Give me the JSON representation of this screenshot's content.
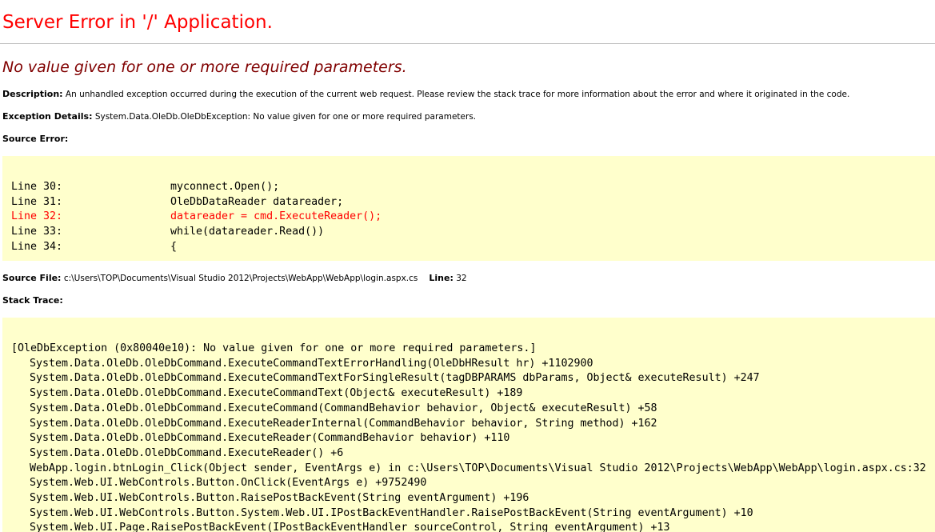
{
  "title": "Server Error in '/' Application.",
  "error_message": "No value given for one or more required parameters.",
  "description": {
    "label": "Description:",
    "text": "An unhandled exception occurred during the execution of the current web request. Please review the stack trace for more information about the error and where it originated in the code."
  },
  "exception_details": {
    "label": "Exception Details:",
    "text": "System.Data.OleDb.OleDbException: No value given for one or more required parameters."
  },
  "source_error": {
    "label": "Source Error:",
    "lines": [
      {
        "number": "Line 30:",
        "code": "myconnect.Open();",
        "error": false
      },
      {
        "number": "Line 31:",
        "code": "OleDbDataReader datareader;",
        "error": false
      },
      {
        "number": "Line 32:",
        "code": "datareader = cmd.ExecuteReader();",
        "error": true
      },
      {
        "number": "Line 33:",
        "code": "while(datareader.Read())",
        "error": false
      },
      {
        "number": "Line 34:",
        "code": "{",
        "error": false
      }
    ]
  },
  "source_file": {
    "label": "Source File:",
    "path": "c:\\Users\\TOP\\Documents\\Visual Studio 2012\\Projects\\WebApp\\WebApp\\login.aspx.cs",
    "line_label": "Line:",
    "line_value": "32"
  },
  "stack_trace": {
    "label": "Stack Trace:",
    "header": "[OleDbException (0x80040e10): No value given for one or more required parameters.]",
    "frames": [
      "System.Data.OleDb.OleDbCommand.ExecuteCommandTextErrorHandling(OleDbHResult hr) +1102900",
      "System.Data.OleDb.OleDbCommand.ExecuteCommandTextForSingleResult(tagDBPARAMS dbParams, Object& executeResult) +247",
      "System.Data.OleDb.OleDbCommand.ExecuteCommandText(Object& executeResult) +189",
      "System.Data.OleDb.OleDbCommand.ExecuteCommand(CommandBehavior behavior, Object& executeResult) +58",
      "System.Data.OleDb.OleDbCommand.ExecuteReaderInternal(CommandBehavior behavior, String method) +162",
      "System.Data.OleDb.OleDbCommand.ExecuteReader(CommandBehavior behavior) +110",
      "System.Data.OleDb.OleDbCommand.ExecuteReader() +6",
      "WebApp.login.btnLogin_Click(Object sender, EventArgs e) in c:\\Users\\TOP\\Documents\\Visual Studio 2012\\Projects\\WebApp\\WebApp\\login.aspx.cs:32",
      "System.Web.UI.WebControls.Button.OnClick(EventArgs e) +9752490",
      "System.Web.UI.WebControls.Button.RaisePostBackEvent(String eventArgument) +196",
      "System.Web.UI.WebControls.Button.System.Web.UI.IPostBackEventHandler.RaisePostBackEvent(String eventArgument) +10",
      "System.Web.UI.Page.RaisePostBackEvent(IPostBackEventHandler sourceControl, String eventArgument) +13"
    ]
  },
  "colors": {
    "title": "#ff0000",
    "error_message": "#800000",
    "code_background": "#ffffcc",
    "error_line": "#ff0000",
    "rule": "#c0c0c0"
  }
}
